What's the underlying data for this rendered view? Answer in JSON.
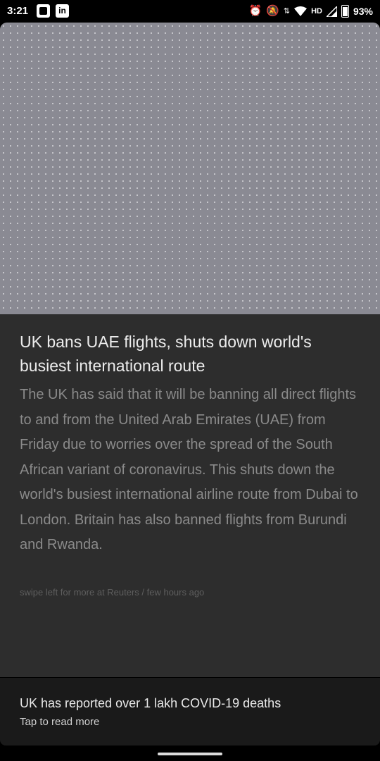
{
  "status_bar": {
    "time": "3:21",
    "left_icons": [
      "notification-icon",
      "linkedin-icon"
    ],
    "linkedin_label": "in",
    "hd_label": "HD",
    "battery_percent": "93%",
    "right_icons": [
      "alarm-icon",
      "do-not-disturb-icon",
      "data-arrows-icon",
      "wifi-icon",
      "signal-icon",
      "battery-icon"
    ]
  },
  "article": {
    "headline": "UK bans UAE flights, shuts down world's busiest international route",
    "body": "The UK has said that it will be banning all direct flights to and from the United Arab Emirates (UAE) from Friday due to worries over the spread of the South African variant of coronavirus. This shuts down the world's busiest international airline route from Dubai to London. Britain has also banned flights from Burundi and Rwanda.",
    "meta": "swipe left for more at Reuters / few hours ago"
  },
  "bottom_panel": {
    "title": "UK has reported over 1 lakh COVID-19 deaths",
    "subtitle": "Tap to read more"
  },
  "colors": {
    "card_bg": "#2d2d2d",
    "image_placeholder": "#8a8a93",
    "bottom_bg": "#1a1a1a"
  }
}
